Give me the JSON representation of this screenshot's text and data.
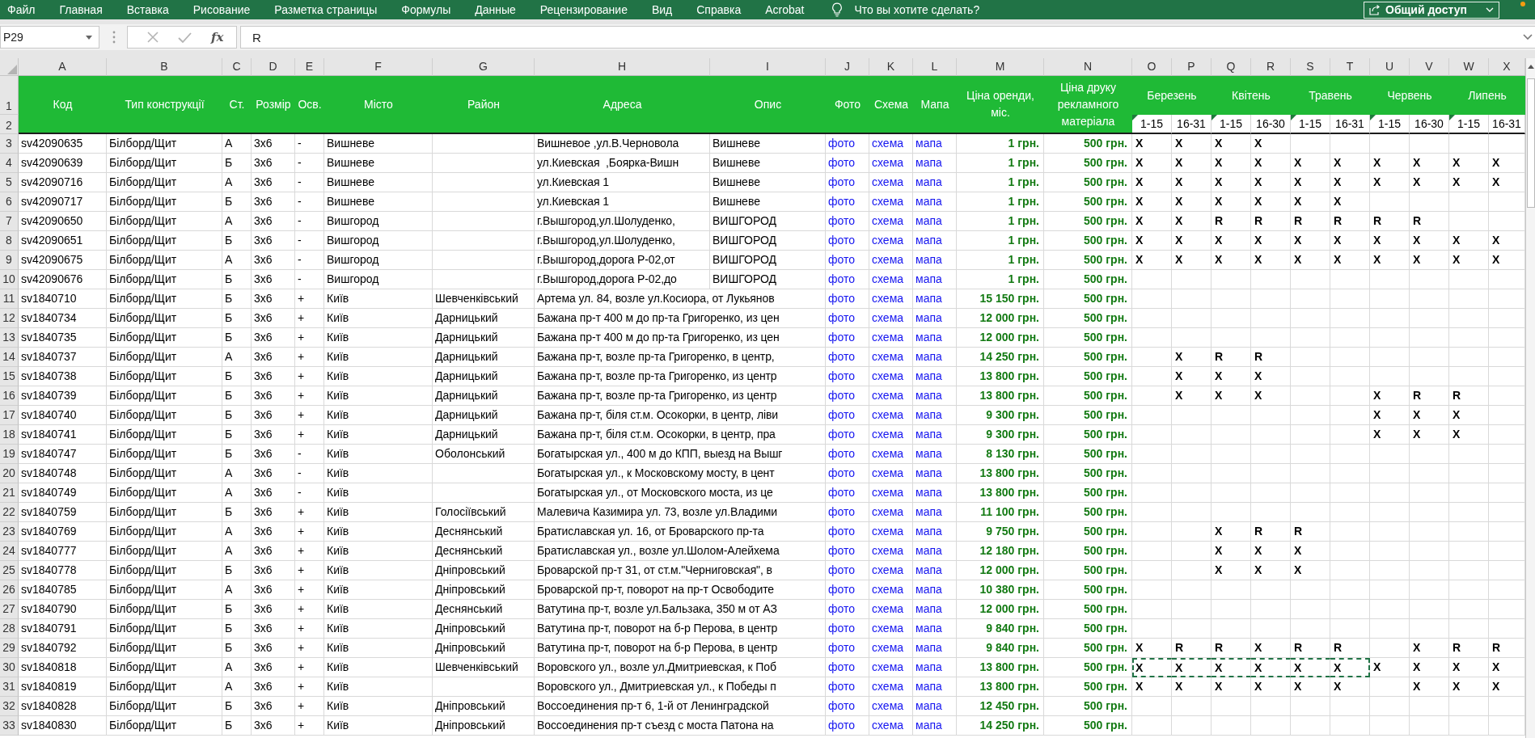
{
  "ribbon": {
    "tabs": [
      "Файл",
      "Главная",
      "Вставка",
      "Рисование",
      "Разметка страницы",
      "Формулы",
      "Данные",
      "Рецензирование",
      "Вид",
      "Справка",
      "Acrobat"
    ],
    "tell_me": {
      "placeholder": "Что вы хотите сделать?"
    },
    "share_button": "Общий доступ"
  },
  "formula_bar": {
    "name_box": "P29",
    "function_label": "fx",
    "value": "R"
  },
  "columns": [
    "A",
    "B",
    "C",
    "D",
    "E",
    "F",
    "G",
    "H",
    "I",
    "J",
    "K",
    "L",
    "M",
    "N",
    "O",
    "P",
    "Q",
    "R",
    "S",
    "T",
    "U",
    "V",
    "W",
    "X"
  ],
  "header": {
    "row_numbers": [
      "1",
      "2"
    ],
    "fields": [
      "Код",
      "Тип конструкції",
      "Ст.",
      "Розмір",
      "Осв.",
      "Місто",
      "Район",
      "Адреса",
      "Опис",
      "Фото",
      "Схема",
      "Мапа",
      "Ціна оренди, міс.",
      "Ціна друку рекламного матеріала"
    ],
    "months": [
      {
        "name": "Березень",
        "halves": [
          {
            "label": "1-15",
            "flagged": true
          },
          {
            "label": "16-31",
            "flagged": false
          }
        ]
      },
      {
        "name": "Квітень",
        "halves": [
          {
            "label": "1-15",
            "flagged": true
          },
          {
            "label": "16-30",
            "flagged": false
          }
        ]
      },
      {
        "name": "Травень",
        "halves": [
          {
            "label": "1-15",
            "flagged": true
          },
          {
            "label": "16-31",
            "flagged": false
          }
        ]
      },
      {
        "name": "Червень",
        "halves": [
          {
            "label": "1-15",
            "flagged": true
          },
          {
            "label": "16-30",
            "flagged": false
          }
        ]
      },
      {
        "name": "Липень",
        "halves": [
          {
            "label": "1-15",
            "flagged": true
          },
          {
            "label": "16-31",
            "flagged": false
          }
        ]
      }
    ]
  },
  "rows": [
    {
      "number": "3",
      "code": "sv42090635",
      "construction_type": "Білборд/Щит",
      "side": "А",
      "size": "3х6",
      "lighting": "-",
      "city": "Вишневе",
      "address": "Вишневое ,ул.В.Черновола",
      "description": "Вишневе",
      "photo": "фото",
      "scheme": "схема",
      "map": "мапа",
      "rent_price": "1 грн.",
      "print_price": "500 грн.",
      "schedule": [
        {
          "kind": "mark",
          "text": "X"
        },
        {
          "kind": "mark",
          "text": "X"
        },
        {
          "kind": "mark",
          "text": "X"
        },
        {
          "kind": "mark",
          "text": "X"
        },
        {
          "kind": "blank"
        },
        {
          "kind": "blank"
        },
        {
          "kind": "blank"
        },
        {
          "kind": "blank"
        },
        {
          "kind": "blank"
        },
        {
          "kind": "blank"
        }
      ]
    },
    {
      "number": "4",
      "code": "sv42090639",
      "construction_type": "Білборд/Щит",
      "side": "Б",
      "size": "3х6",
      "lighting": "-",
      "city": "Вишневе",
      "address": "ул.Киевская  ,Боярка-Вишн",
      "description": "Вишневе",
      "photo": "фото",
      "scheme": "схема",
      "map": "мапа",
      "rent_price": "1 грн.",
      "print_price": "500 грн.",
      "schedule": [
        {
          "kind": "mark",
          "text": "X"
        },
        {
          "kind": "mark",
          "text": "X"
        },
        {
          "kind": "mark",
          "text": "X"
        },
        {
          "kind": "mark",
          "text": "X"
        },
        {
          "kind": "mark",
          "text": "X"
        },
        {
          "kind": "mark",
          "text": "X"
        },
        {
          "kind": "mark",
          "text": "X"
        },
        {
          "kind": "mark",
          "text": "X"
        },
        {
          "kind": "mark",
          "text": "X"
        },
        {
          "kind": "mark",
          "text": "X"
        }
      ]
    },
    {
      "number": "5",
      "code": "sv42090716",
      "construction_type": "Білборд/Щит",
      "side": "А",
      "size": "3х6",
      "lighting": "-",
      "city": "Вишневе",
      "address": "ул.Киевская 1",
      "description": "Вишневе",
      "photo": "фото",
      "scheme": "схема",
      "map": "мапа",
      "rent_price": "1 грн.",
      "print_price": "500 грн.",
      "schedule": [
        {
          "kind": "mark",
          "text": "X"
        },
        {
          "kind": "mark",
          "text": "X"
        },
        {
          "kind": "mark",
          "text": "X"
        },
        {
          "kind": "mark",
          "text": "X"
        },
        {
          "kind": "mark",
          "text": "X"
        },
        {
          "kind": "mark",
          "text": "X"
        },
        {
          "kind": "mark",
          "text": "X"
        },
        {
          "kind": "mark",
          "text": "X"
        },
        {
          "kind": "mark",
          "text": "X"
        },
        {
          "kind": "mark",
          "text": "X"
        }
      ]
    },
    {
      "number": "6",
      "code": "sv42090717",
      "construction_type": "Білборд/Щит",
      "side": "Б",
      "size": "3х6",
      "lighting": "-",
      "city": "Вишневе",
      "address": "ул.Киевская 1",
      "description": "Вишневе",
      "photo": "фото",
      "scheme": "схема",
      "map": "мапа",
      "rent_price": "1 грн.",
      "print_price": "500 грн.",
      "schedule": [
        {
          "kind": "mark",
          "text": "X"
        },
        {
          "kind": "mark",
          "text": "X"
        },
        {
          "kind": "mark",
          "text": "X"
        },
        {
          "kind": "mark",
          "text": "X"
        },
        {
          "kind": "mark",
          "text": "X"
        },
        {
          "kind": "mark",
          "text": "X"
        },
        {
          "kind": "blank"
        },
        {
          "kind": "blank"
        },
        {
          "kind": "blank"
        },
        {
          "kind": "blank"
        }
      ]
    },
    {
      "number": "7",
      "code": "sv42090650",
      "construction_type": "Білборд/Щит",
      "side": "А",
      "size": "3х6",
      "lighting": "-",
      "city": "Вишгород",
      "address": "г.Вышгород,ул.Шолуденко,",
      "description": "ВИШГОРОД",
      "photo": "фото",
      "scheme": "схема",
      "map": "мапа",
      "rent_price": "1 грн.",
      "print_price": "500 грн.",
      "schedule": [
        {
          "kind": "mark",
          "text": "X"
        },
        {
          "kind": "mark",
          "text": "X"
        },
        {
          "kind": "mark",
          "text": "R"
        },
        {
          "kind": "mark",
          "text": "R"
        },
        {
          "kind": "mark",
          "text": "R"
        },
        {
          "kind": "mark",
          "text": "R"
        },
        {
          "kind": "mark",
          "text": "R"
        },
        {
          "kind": "mark",
          "text": "R"
        },
        {
          "kind": "blank"
        },
        {
          "kind": "blank"
        }
      ]
    },
    {
      "number": "8",
      "code": "sv42090651",
      "construction_type": "Білборд/Щит",
      "side": "Б",
      "size": "3х6",
      "lighting": "-",
      "city": "Вишгород",
      "address": "г.Вышгород,ул.Шолуденко,",
      "description": "ВИШГОРОД",
      "photo": "фото",
      "scheme": "схема",
      "map": "мапа",
      "rent_price": "1 грн.",
      "print_price": "500 грн.",
      "schedule": [
        {
          "kind": "mark",
          "text": "X"
        },
        {
          "kind": "mark",
          "text": "X"
        },
        {
          "kind": "mark",
          "text": "X"
        },
        {
          "kind": "mark",
          "text": "X"
        },
        {
          "kind": "mark",
          "text": "X"
        },
        {
          "kind": "mark",
          "text": "X"
        },
        {
          "kind": "mark",
          "text": "X"
        },
        {
          "kind": "mark",
          "text": "X"
        },
        {
          "kind": "mark",
          "text": "X"
        },
        {
          "kind": "mark",
          "text": "X"
        }
      ]
    },
    {
      "number": "9",
      "code": "sv42090675",
      "construction_type": "Білборд/Щит",
      "side": "А",
      "size": "3х6",
      "lighting": "-",
      "city": "Вишгород",
      "address": "г.Вышгород,дорога Р-02,от",
      "description": "ВИШГОРОД",
      "photo": "фото",
      "scheme": "схема",
      "map": "мапа",
      "rent_price": "1 грн.",
      "print_price": "500 грн.",
      "schedule": [
        {
          "kind": "mark",
          "text": "X"
        },
        {
          "kind": "mark",
          "text": "X"
        },
        {
          "kind": "mark",
          "text": "X"
        },
        {
          "kind": "mark",
          "text": "X"
        },
        {
          "kind": "mark",
          "text": "X"
        },
        {
          "kind": "mark",
          "text": "X"
        },
        {
          "kind": "mark",
          "text": "X"
        },
        {
          "kind": "mark",
          "text": "X"
        },
        {
          "kind": "mark",
          "text": "X"
        },
        {
          "kind": "mark",
          "text": "X"
        }
      ]
    },
    {
      "number": "10",
      "code": "sv42090676",
      "construction_type": "Білборд/Щит",
      "side": "Б",
      "size": "3х6",
      "lighting": "-",
      "city": "Вишгород",
      "address": "г.Вышгород,дорога Р-02,до",
      "description": "ВИШГОРОД",
      "photo": "фото",
      "scheme": "схема",
      "map": "мапа",
      "rent_price": "1 грн.",
      "print_price": "500 грн."
    },
    {
      "number": "11",
      "code": "sv1840710",
      "construction_type": "Білборд/Щит",
      "side": "Б",
      "size": "3х6",
      "lighting": "+",
      "city": "Київ",
      "district": "Шевченківський",
      "address": "Артема ул. 84, возле ул.Косиора, от Лукьянов",
      "photo": "фото",
      "scheme": "схема",
      "map": "мапа",
      "rent_price": "15 150 грн.",
      "print_price": "500 грн."
    },
    {
      "number": "12",
      "code": "sv1840734",
      "construction_type": "Білборд/Щит",
      "side": "Б",
      "size": "3х6",
      "lighting": "+",
      "city": "Київ",
      "district": "Дарницький",
      "address": "Бажана пр-т 400 м до пр-та Григоренко, из цен",
      "photo": "фото",
      "scheme": "схема",
      "map": "мапа",
      "rent_price": "12 000 грн.",
      "print_price": "500 грн."
    },
    {
      "number": "13",
      "code": "sv1840735",
      "construction_type": "Білборд/Щит",
      "side": "Б",
      "size": "3х6",
      "lighting": "+",
      "city": "Київ",
      "district": "Дарницький",
      "address": "Бажана пр-т 400 м до пр-та Григоренко, из цен",
      "photo": "фото",
      "scheme": "схема",
      "map": "мапа",
      "rent_price": "12 000 грн.",
      "print_price": "500 грн."
    },
    {
      "number": "14",
      "code": "sv1840737",
      "construction_type": "Білборд/Щит",
      "side": "А",
      "size": "3х6",
      "lighting": "+",
      "city": "Київ",
      "district": "Дарницький",
      "address": "Бажана пр-т, возле пр-та Григоренко, в центр,",
      "photo": "фото",
      "scheme": "схема",
      "map": "мапа",
      "rent_price": "14 250 грн.",
      "print_price": "500 грн.",
      "schedule": [
        {
          "kind": "blank"
        },
        {
          "kind": "mark",
          "text": "X"
        },
        {
          "kind": "mark",
          "text": "R"
        },
        {
          "kind": "mark",
          "text": "R"
        },
        {
          "kind": "blank"
        },
        {
          "kind": "blank"
        },
        {
          "kind": "blank"
        },
        {
          "kind": "blank"
        },
        {
          "kind": "blank"
        },
        {
          "kind": "blank"
        }
      ]
    },
    {
      "number": "15",
      "code": "sv1840738",
      "construction_type": "Білборд/Щит",
      "side": "Б",
      "size": "3х6",
      "lighting": "+",
      "city": "Київ",
      "district": "Дарницький",
      "address": "Бажана пр-т, возле пр-та Григоренко, из центр",
      "photo": "фото",
      "scheme": "схема",
      "map": "мапа",
      "rent_price": "13 800 грн.",
      "print_price": "500 грн.",
      "schedule": [
        {
          "kind": "blank"
        },
        {
          "kind": "mark",
          "text": "X"
        },
        {
          "kind": "mark",
          "text": "X"
        },
        {
          "kind": "mark",
          "text": "X"
        },
        {
          "kind": "blank"
        },
        {
          "kind": "blank"
        },
        {
          "kind": "blank"
        },
        {
          "kind": "blank"
        },
        {
          "kind": "blank"
        },
        {
          "kind": "blank"
        }
      ]
    },
    {
      "number": "16",
      "code": "sv1840739",
      "construction_type": "Білборд/Щит",
      "side": "Б",
      "size": "3х6",
      "lighting": "+",
      "city": "Київ",
      "district": "Дарницький",
      "address": "Бажана пр-т, возле пр-та Григоренко, из центр",
      "photo": "фото",
      "scheme": "схема",
      "map": "мапа",
      "rent_price": "13 800 грн.",
      "print_price": "500 грн.",
      "schedule": [
        {
          "kind": "blank"
        },
        {
          "kind": "mark",
          "text": "X"
        },
        {
          "kind": "mark",
          "text": "X"
        },
        {
          "kind": "mark",
          "text": "X"
        },
        {
          "kind": "blank"
        },
        {
          "kind": "blank"
        },
        {
          "kind": "mark",
          "text": "X"
        },
        {
          "kind": "mark",
          "text": "R"
        },
        {
          "kind": "mark",
          "text": "R"
        },
        {
          "kind": "blank"
        }
      ]
    },
    {
      "number": "17",
      "code": "sv1840740",
      "construction_type": "Білборд/Щит",
      "side": "Б",
      "size": "3х6",
      "lighting": "+",
      "city": "Київ",
      "district": "Дарницький",
      "address": "Бажана пр-т, біля ст.м. Осокорки, в центр, ліви",
      "photo": "фото",
      "scheme": "схема",
      "map": "мапа",
      "rent_price": "9 300 грн.",
      "print_price": "500 грн.",
      "schedule": [
        {
          "kind": "blank"
        },
        {
          "kind": "blank"
        },
        {
          "kind": "blank"
        },
        {
          "kind": "blank"
        },
        {
          "kind": "blank"
        },
        {
          "kind": "blank"
        },
        {
          "kind": "mark",
          "text": "X"
        },
        {
          "kind": "mark",
          "text": "X"
        },
        {
          "kind": "mark",
          "text": "X"
        },
        {
          "kind": "blank"
        }
      ]
    },
    {
      "number": "18",
      "code": "sv1840741",
      "construction_type": "Білборд/Щит",
      "side": "Б",
      "size": "3х6",
      "lighting": "+",
      "city": "Київ",
      "district": "Дарницький",
      "address": "Бажана пр-т, біля ст.м. Осокорки, в центр, пра",
      "photo": "фото",
      "scheme": "схема",
      "map": "мапа",
      "rent_price": "9 300 грн.",
      "print_price": "500 грн.",
      "schedule": [
        {
          "kind": "blank"
        },
        {
          "kind": "blank"
        },
        {
          "kind": "blank"
        },
        {
          "kind": "blank"
        },
        {
          "kind": "blank"
        },
        {
          "kind": "blank"
        },
        {
          "kind": "mark",
          "text": "X"
        },
        {
          "kind": "mark",
          "text": "X"
        },
        {
          "kind": "mark",
          "text": "X"
        },
        {
          "kind": "blank"
        }
      ]
    },
    {
      "number": "19",
      "code": "sv1840747",
      "construction_type": "Білборд/Щит",
      "side": "Б",
      "size": "3х6",
      "lighting": "-",
      "city": "Київ",
      "district": "Оболонський",
      "address": "Богатырская ул., 400 м до КПП, выезд на Вышг",
      "photo": "фото",
      "scheme": "схема",
      "map": "мапа",
      "rent_price": "8 130 грн.",
      "print_price": "500 грн."
    },
    {
      "number": "20",
      "code": "sv1840748",
      "construction_type": "Білборд/Щит",
      "side": "А",
      "size": "3х6",
      "lighting": "-",
      "city": "Київ",
      "address": "Богатырская ул., к Московскому мосту, в цент",
      "photo": "фото",
      "scheme": "схема",
      "map": "мапа",
      "rent_price": "13 800 грн.",
      "print_price": "500 грн."
    },
    {
      "number": "21",
      "code": "sv1840749",
      "construction_type": "Білборд/Щит",
      "side": "А",
      "size": "3х6",
      "lighting": "-",
      "city": "Київ",
      "address": "Богатырская ул., от Московского моста, из це",
      "photo": "фото",
      "scheme": "схема",
      "map": "мапа",
      "rent_price": "13 800 грн.",
      "print_price": "500 грн."
    },
    {
      "number": "22",
      "code": "sv1840759",
      "construction_type": "Білборд/Щит",
      "side": "Б",
      "size": "3х6",
      "lighting": "+",
      "city": "Київ",
      "district": "Голосіївський",
      "address": "Малевича Казимира ул. 73, возле ул.Владими",
      "photo": "фото",
      "scheme": "схема",
      "map": "мапа",
      "rent_price": "11 100 грн.",
      "print_price": "500 грн."
    },
    {
      "number": "23",
      "code": "sv1840769",
      "construction_type": "Білборд/Щит",
      "side": "А",
      "size": "3х6",
      "lighting": "+",
      "city": "Київ",
      "district": "Деснянський",
      "address": "Братиславская ул. 16, от Броварского пр-та",
      "photo": "фото",
      "scheme": "схема",
      "map": "мапа",
      "rent_price": "9 750 грн.",
      "print_price": "500 грн.",
      "schedule": [
        {
          "kind": "blank"
        },
        {
          "kind": "blank"
        },
        {
          "kind": "mark",
          "text": "X"
        },
        {
          "kind": "mark",
          "text": "R"
        },
        {
          "kind": "mark",
          "text": "R"
        },
        {
          "kind": "blank"
        },
        {
          "kind": "blank"
        },
        {
          "kind": "blank"
        },
        {
          "kind": "blank"
        },
        {
          "kind": "blank"
        }
      ]
    },
    {
      "number": "24",
      "code": "sv1840777",
      "construction_type": "Білборд/Щит",
      "side": "А",
      "size": "3х6",
      "lighting": "+",
      "city": "Київ",
      "district": "Деснянський",
      "address": "Братиславская ул., возле ул.Шолом-Алейхема",
      "photo": "фото",
      "scheme": "схема",
      "map": "мапа",
      "rent_price": "12 180 грн.",
      "print_price": "500 грн.",
      "schedule": [
        {
          "kind": "blank"
        },
        {
          "kind": "blank"
        },
        {
          "kind": "mark",
          "text": "X"
        },
        {
          "kind": "mark",
          "text": "X"
        },
        {
          "kind": "mark",
          "text": "X"
        },
        {
          "kind": "blank"
        },
        {
          "kind": "blank"
        },
        {
          "kind": "blank"
        },
        {
          "kind": "blank"
        },
        {
          "kind": "blank"
        }
      ]
    },
    {
      "number": "25",
      "code": "sv1840778",
      "construction_type": "Білборд/Щит",
      "side": "Б",
      "size": "3х6",
      "lighting": "+",
      "city": "Київ",
      "district": "Дніпровський",
      "address": "Броварской пр-т 31, от ст.м.\"Черниговская\", в",
      "photo": "фото",
      "scheme": "схема",
      "map": "мапа",
      "rent_price": "12 000 грн.",
      "print_price": "500 грн.",
      "schedule": [
        {
          "kind": "blank"
        },
        {
          "kind": "blank"
        },
        {
          "kind": "mark",
          "text": "X"
        },
        {
          "kind": "mark",
          "text": "X"
        },
        {
          "kind": "mark",
          "text": "X"
        },
        {
          "kind": "blank"
        },
        {
          "kind": "blank"
        },
        {
          "kind": "blank"
        },
        {
          "kind": "blank"
        },
        {
          "kind": "blank"
        }
      ]
    },
    {
      "number": "26",
      "code": "sv1840785",
      "construction_type": "Білборд/Щит",
      "side": "А",
      "size": "3х6",
      "lighting": "+",
      "city": "Київ",
      "district": "Дніпровський",
      "address": "Броварской пр-т, поворот на пр-т Освободите",
      "photo": "фото",
      "scheme": "схема",
      "map": "мапа",
      "rent_price": "10 380 грн.",
      "print_price": "500 грн."
    },
    {
      "number": "27",
      "code": "sv1840790",
      "construction_type": "Білборд/Щит",
      "side": "Б",
      "size": "3х6",
      "lighting": "+",
      "city": "Київ",
      "district": "Деснянський",
      "address": "Ватутина пр-т, возле ул.Бальзака, 350 м от АЗ",
      "photo": "фото",
      "scheme": "схема",
      "map": "мапа",
      "rent_price": "12 000 грн.",
      "print_price": "500 грн."
    },
    {
      "number": "28",
      "code": "sv1840791",
      "construction_type": "Білборд/Щит",
      "side": "Б",
      "size": "3х6",
      "lighting": "+",
      "city": "Київ",
      "district": "Дніпровський",
      "address": "Ватутина пр-т, поворот на б-р Перова, в центр",
      "photo": "фото",
      "scheme": "схема",
      "map": "мапа",
      "rent_price": "9 840 грн.",
      "print_price": "500 грн."
    },
    {
      "number": "29",
      "code": "sv1840792",
      "construction_type": "Білборд/Щит",
      "side": "Б",
      "size": "3х6",
      "lighting": "+",
      "city": "Київ",
      "district": "Дніпровський",
      "address": "Ватутина пр-т, поворот на б-р Перова, в центр",
      "photo": "фото",
      "scheme": "схема",
      "map": "мапа",
      "rent_price": "9 840 грн.",
      "print_price": "500 грн.",
      "schedule": [
        {
          "kind": "mark",
          "text": "X"
        },
        {
          "kind": "mark",
          "text": "R"
        },
        {
          "kind": "mark",
          "text": "R"
        },
        {
          "kind": "mark",
          "text": "X"
        },
        {
          "kind": "mark",
          "text": "R"
        },
        {
          "kind": "mark",
          "text": "R"
        },
        {
          "kind": "blank"
        },
        {
          "kind": "mark",
          "text": "X"
        },
        {
          "kind": "mark",
          "text": "R"
        },
        {
          "kind": "mark",
          "text": "R"
        }
      ]
    },
    {
      "number": "30",
      "code": "sv1840818",
      "construction_type": "Білборд/Щит",
      "side": "А",
      "size": "3х6",
      "lighting": "+",
      "city": "Київ",
      "district": "Шевченківський",
      "address": "Воровского ул., возле ул.Дмитриевская, к Поб",
      "photo": "фото",
      "scheme": "схема",
      "map": "мапа",
      "rent_price": "13 800 грн.",
      "print_price": "500 грн.",
      "schedule": [
        {
          "kind": "mark",
          "text": "X",
          "copied": true
        },
        {
          "kind": "mark",
          "text": "X",
          "copied": true
        },
        {
          "kind": "mark",
          "text": "X",
          "copied": true
        },
        {
          "kind": "mark",
          "text": "X",
          "copied": true
        },
        {
          "kind": "mark",
          "text": "X",
          "copied": true
        },
        {
          "kind": "mark",
          "text": "X",
          "copied": true
        },
        {
          "kind": "mark",
          "text": "X"
        },
        {
          "kind": "mark",
          "text": "X"
        },
        {
          "kind": "mark",
          "text": "X"
        },
        {
          "kind": "mark",
          "text": "X"
        }
      ]
    },
    {
      "number": "31",
      "code": "sv1840819",
      "construction_type": "Білборд/Щит",
      "side": "А",
      "size": "3х6",
      "lighting": "+",
      "city": "Київ",
      "address": "Воровского ул., Дмитриевская ул., к Победы п",
      "photo": "фото",
      "scheme": "схема",
      "map": "мапа",
      "rent_price": "13 800 грн.",
      "print_price": "500 грн.",
      "schedule": [
        {
          "kind": "mark",
          "text": "X"
        },
        {
          "kind": "mark",
          "text": "X"
        },
        {
          "kind": "mark",
          "text": "X"
        },
        {
          "kind": "mark",
          "text": "X"
        },
        {
          "kind": "mark",
          "text": "X"
        },
        {
          "kind": "mark",
          "text": "X"
        },
        {
          "kind": "blank"
        },
        {
          "kind": "mark",
          "text": "X"
        },
        {
          "kind": "mark",
          "text": "X"
        },
        {
          "kind": "mark",
          "text": "X"
        }
      ]
    },
    {
      "number": "32",
      "code": "sv1840828",
      "construction_type": "Білборд/Щит",
      "side": "Б",
      "size": "3х6",
      "lighting": "+",
      "city": "Київ",
      "district": "Дніпровський",
      "address": "Воссоединения пр-т 6, 1-й от Ленинградской",
      "photo": "фото",
      "scheme": "схема",
      "map": "мапа",
      "rent_price": "12 450 грн.",
      "print_price": "500 грн."
    },
    {
      "number": "33",
      "code": "sv1840830",
      "construction_type": "Білборд/Щит",
      "side": "Б",
      "size": "3х6",
      "lighting": "+",
      "city": "Київ",
      "district": "Дніпровський",
      "address": "Воссоединения пр-т съезд с моста Патона на",
      "photo": "фото",
      "scheme": "схема",
      "map": "мапа",
      "rent_price": "14 250 грн.",
      "print_price": "500 грн."
    }
  ]
}
